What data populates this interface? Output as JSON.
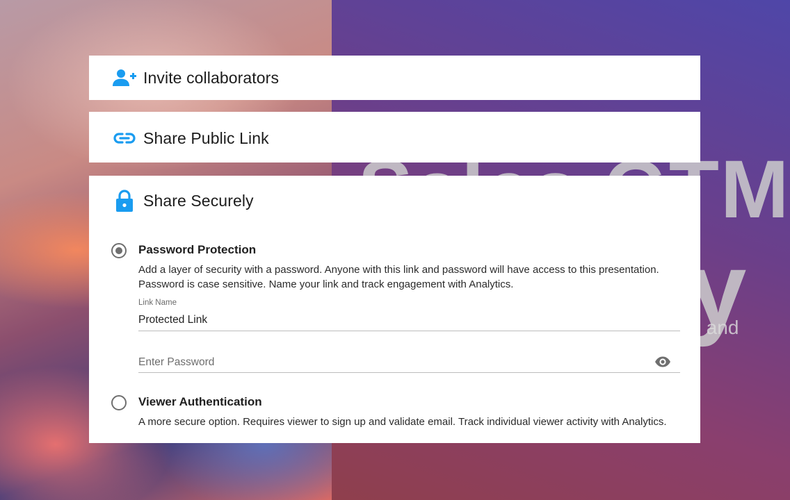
{
  "background": {
    "title_text": "Sales GTM",
    "letter_text": "y",
    "sub_text": "re and"
  },
  "panels": {
    "invite": {
      "label": "Invite collaborators",
      "icon": "person-add-icon"
    },
    "public_link": {
      "label": "Share Public Link",
      "icon": "link-icon"
    },
    "secure": {
      "label": "Share Securely",
      "icon": "lock-icon"
    }
  },
  "options": {
    "password": {
      "title": "Password Protection",
      "description": "Add a layer of security with a password. Anyone with this link and password will have access to this presentation. Password is case sensitive. Name your link and track engagement with Analytics.",
      "selected": true,
      "link_name_label": "Link Name",
      "link_name_value": "Protected Link",
      "password_placeholder": "Enter Password",
      "toggle_icon": "eye-icon"
    },
    "viewer_auth": {
      "title": "Viewer Authentication",
      "description": "A more secure option. Requires viewer to sign up and validate email. Track individual viewer activity with Analytics.",
      "selected": false
    }
  },
  "colors": {
    "accent": "#1a9cf0",
    "radio": "#6f6f6f",
    "panel_bg": "#ffffff"
  }
}
